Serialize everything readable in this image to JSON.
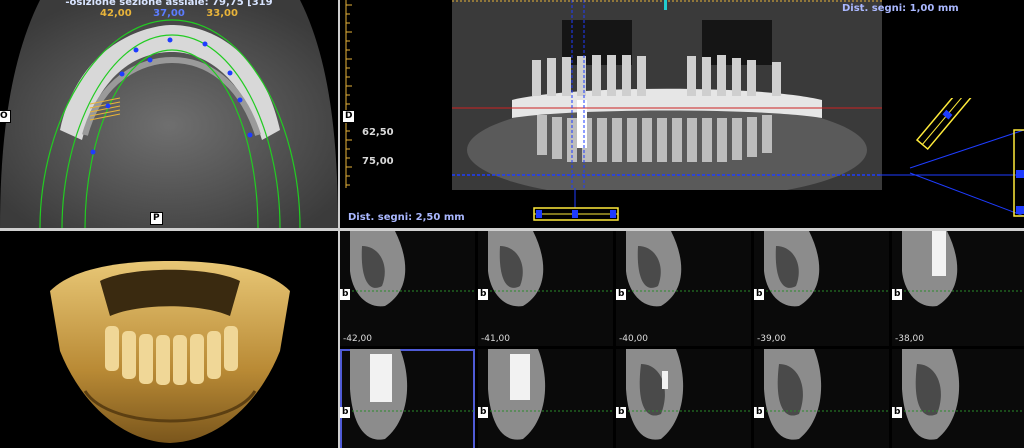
{
  "axial": {
    "title": "-osizione sezione assiale: 79,75 [319",
    "values": [
      "42,00",
      "37,00",
      "33,00"
    ],
    "value_colors": [
      "#e8b43a",
      "#5b7cff",
      "#e8b43a"
    ],
    "orient_left": "O",
    "orient_bottom": "P"
  },
  "panoramic": {
    "orient_left": "D",
    "ruler_labels": [
      "62,50",
      "75,00"
    ],
    "dist_top": "Dist. segni: 1,00 mm",
    "dist_bottom": "Dist. segni: 2,50 mm"
  },
  "cross_sections": {
    "side_label": "b",
    "rows": [
      {
        "slices": [
          "-42,00",
          "-41,00",
          "-40,00",
          "-39,00",
          "-38,00"
        ]
      },
      {
        "slices": [
          "",
          "",
          "",
          "",
          ""
        ]
      }
    ],
    "selected_index": 5
  },
  "colors": {
    "separator": "#cfcfcf",
    "selection": "#4f5bd6",
    "ruler": "#e8b43a",
    "guide_blue": "#1e3cff",
    "arch_green": "#22cc22"
  }
}
